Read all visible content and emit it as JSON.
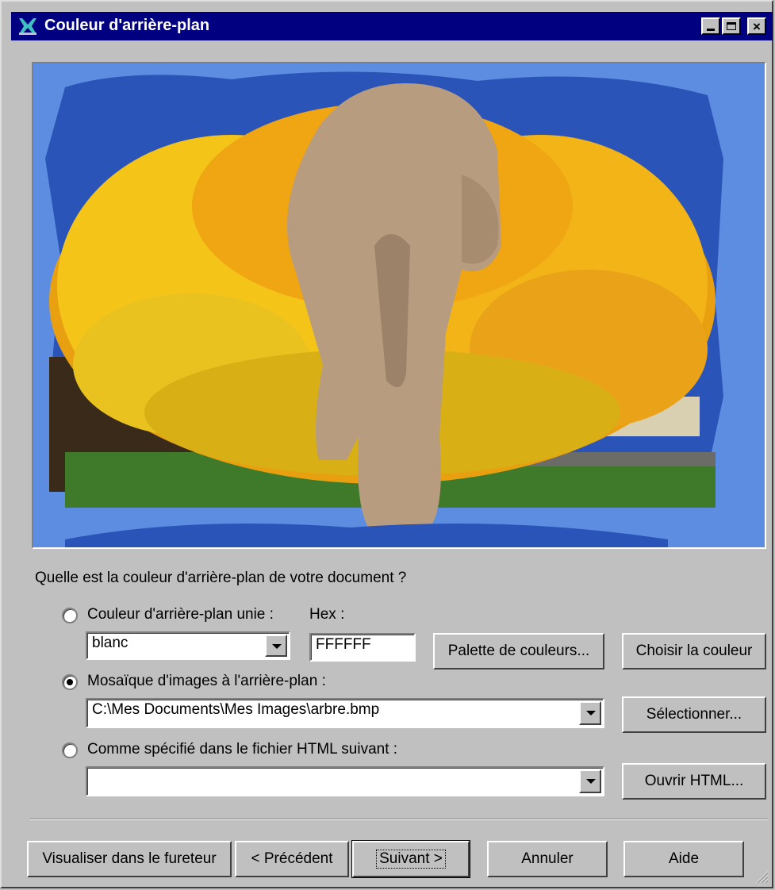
{
  "window": {
    "title": "Couleur d'arrière-plan",
    "controls": [
      "minimize-icon",
      "maximize-icon",
      "close-icon"
    ]
  },
  "question": "Quelle est la couleur d'arrière-plan de votre document ?",
  "options": {
    "solid_color": {
      "label": "Couleur d'arrière-plan unie :",
      "checked": false,
      "color_value": "blanc",
      "hex_label": "Hex :",
      "hex_value": "FFFFFF",
      "palette_button": "Palette de couleurs...",
      "choose_button": "Choisir la couleur"
    },
    "tiled_image": {
      "label": "Mosaïque d'images à l'arrière-plan :",
      "checked": true,
      "path_value": "C:\\Mes Documents\\Mes Images\\arbre.bmp",
      "select_button": "Sélectionner..."
    },
    "html_file": {
      "label": "Comme spécifié dans le fichier HTML suivant :",
      "checked": false,
      "path_value": "",
      "open_button": "Ouvrir HTML..."
    }
  },
  "footer": {
    "preview_button": "Visualiser dans le fureteur",
    "back_button": "< Précédent",
    "next_button": "Suivant >",
    "cancel_button": "Annuler",
    "help_button": "Aide"
  },
  "colors": {
    "titlebar": "#000080",
    "face": "#c0c0c0",
    "preview_background": "#5d8de0"
  }
}
